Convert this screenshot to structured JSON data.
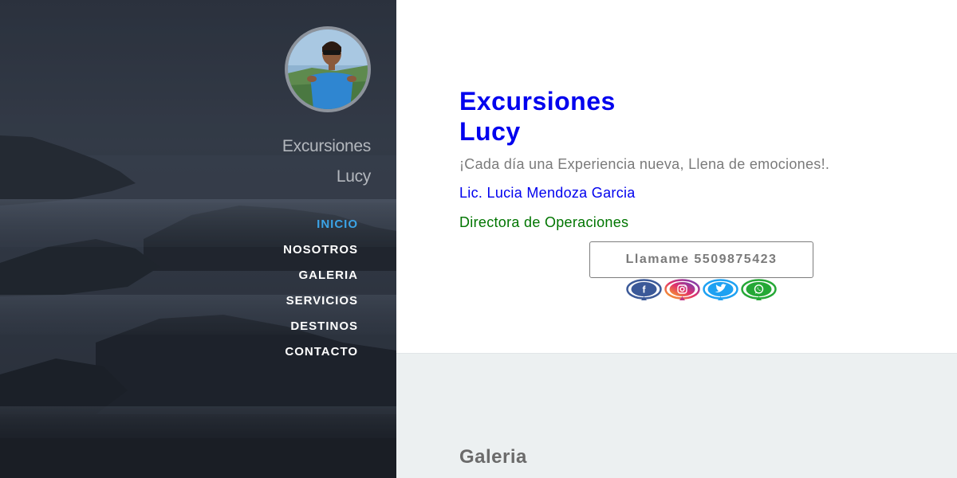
{
  "sidebar": {
    "title_line1": "Excursiones",
    "title_line2": "Lucy",
    "nav": [
      {
        "label": "INICIO",
        "active": true
      },
      {
        "label": "NOSOTROS"
      },
      {
        "label": "GALERIA"
      },
      {
        "label": "SERVICIOS"
      },
      {
        "label": "DESTINOS"
      },
      {
        "label": "CONTACTO"
      }
    ]
  },
  "hero": {
    "title_line1": "Excursiones",
    "title_line2": "Lucy",
    "tagline": "¡Cada día una Experiencia nueva, Llena de emociones!.",
    "name": "Lic. Lucia Mendoza Garcia",
    "role": "Directora de Operaciones",
    "call_button_label": "Llamame 5509875423",
    "social": [
      {
        "icon": "facebook-icon",
        "color": "#3b5998"
      },
      {
        "icon": "instagram-icon",
        "color": "#c13584"
      },
      {
        "icon": "twitter-icon",
        "color": "#1da1f2"
      },
      {
        "icon": "whatsapp-icon",
        "color": "#25a836"
      }
    ]
  },
  "gallery": {
    "title": "Galeria"
  },
  "colors": {
    "link_blue": "#0000ee",
    "role_green": "#007500",
    "nav_active": "#3ba3e6",
    "gallery_bg": "#ecf0f1"
  }
}
